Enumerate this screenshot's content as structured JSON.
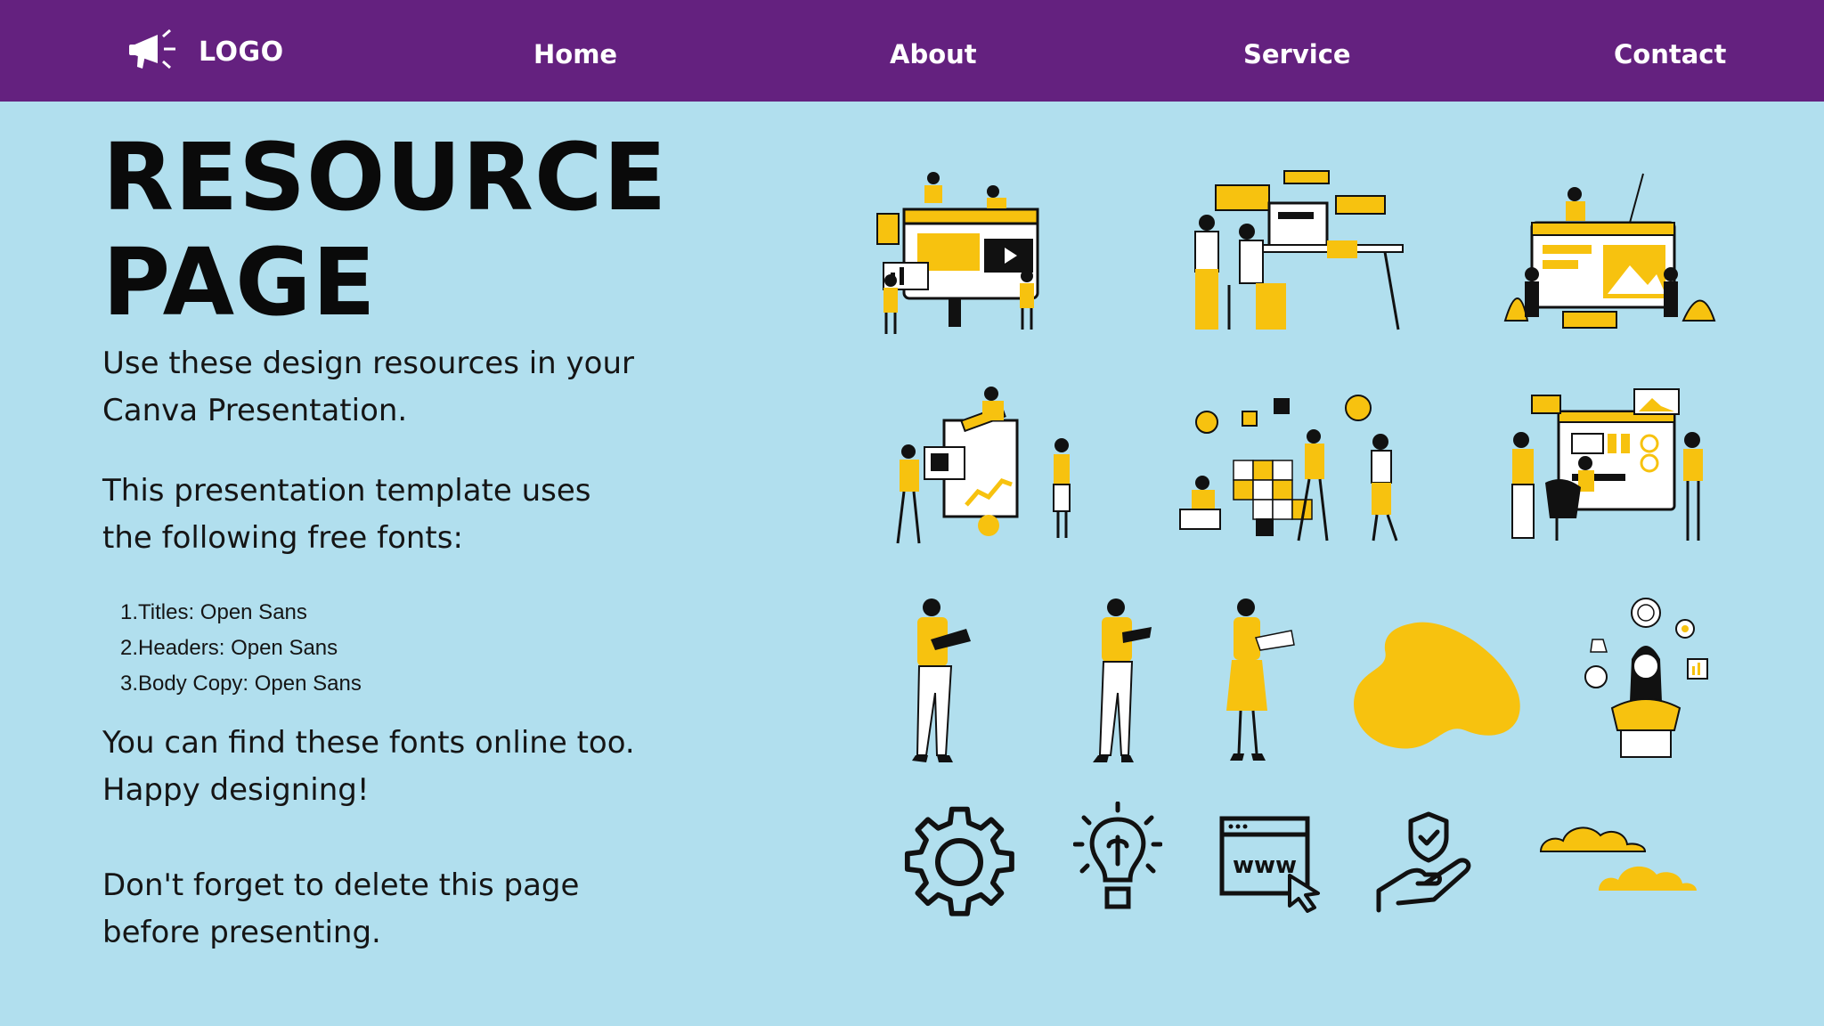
{
  "nav": {
    "logo_label": "LOGO",
    "logo_icon": "megaphone-icon",
    "links": [
      "Home",
      "About",
      "Service",
      "Contact"
    ]
  },
  "title_lines": [
    "RESOURCE",
    "PAGE"
  ],
  "intro": [
    "Use these design resources in your",
    "Canva Presentation."
  ],
  "fonts_intro": [
    "This presentation template uses",
    "the following free fonts:"
  ],
  "fonts_list": [
    "1.Titles: Open Sans",
    "2.Headers: Open Sans",
    "3.Body Copy: Open Sans"
  ],
  "outro": [
    "You can find these fonts online too.",
    "Happy designing!"
  ],
  "reminder": [
    "Don't forget to delete this page",
    "before presenting."
  ],
  "colors": {
    "nav_bg": "#64217f",
    "page_bg": "#b1dfee",
    "accent": "#f7c20f",
    "ink": "#0a0a0a"
  }
}
